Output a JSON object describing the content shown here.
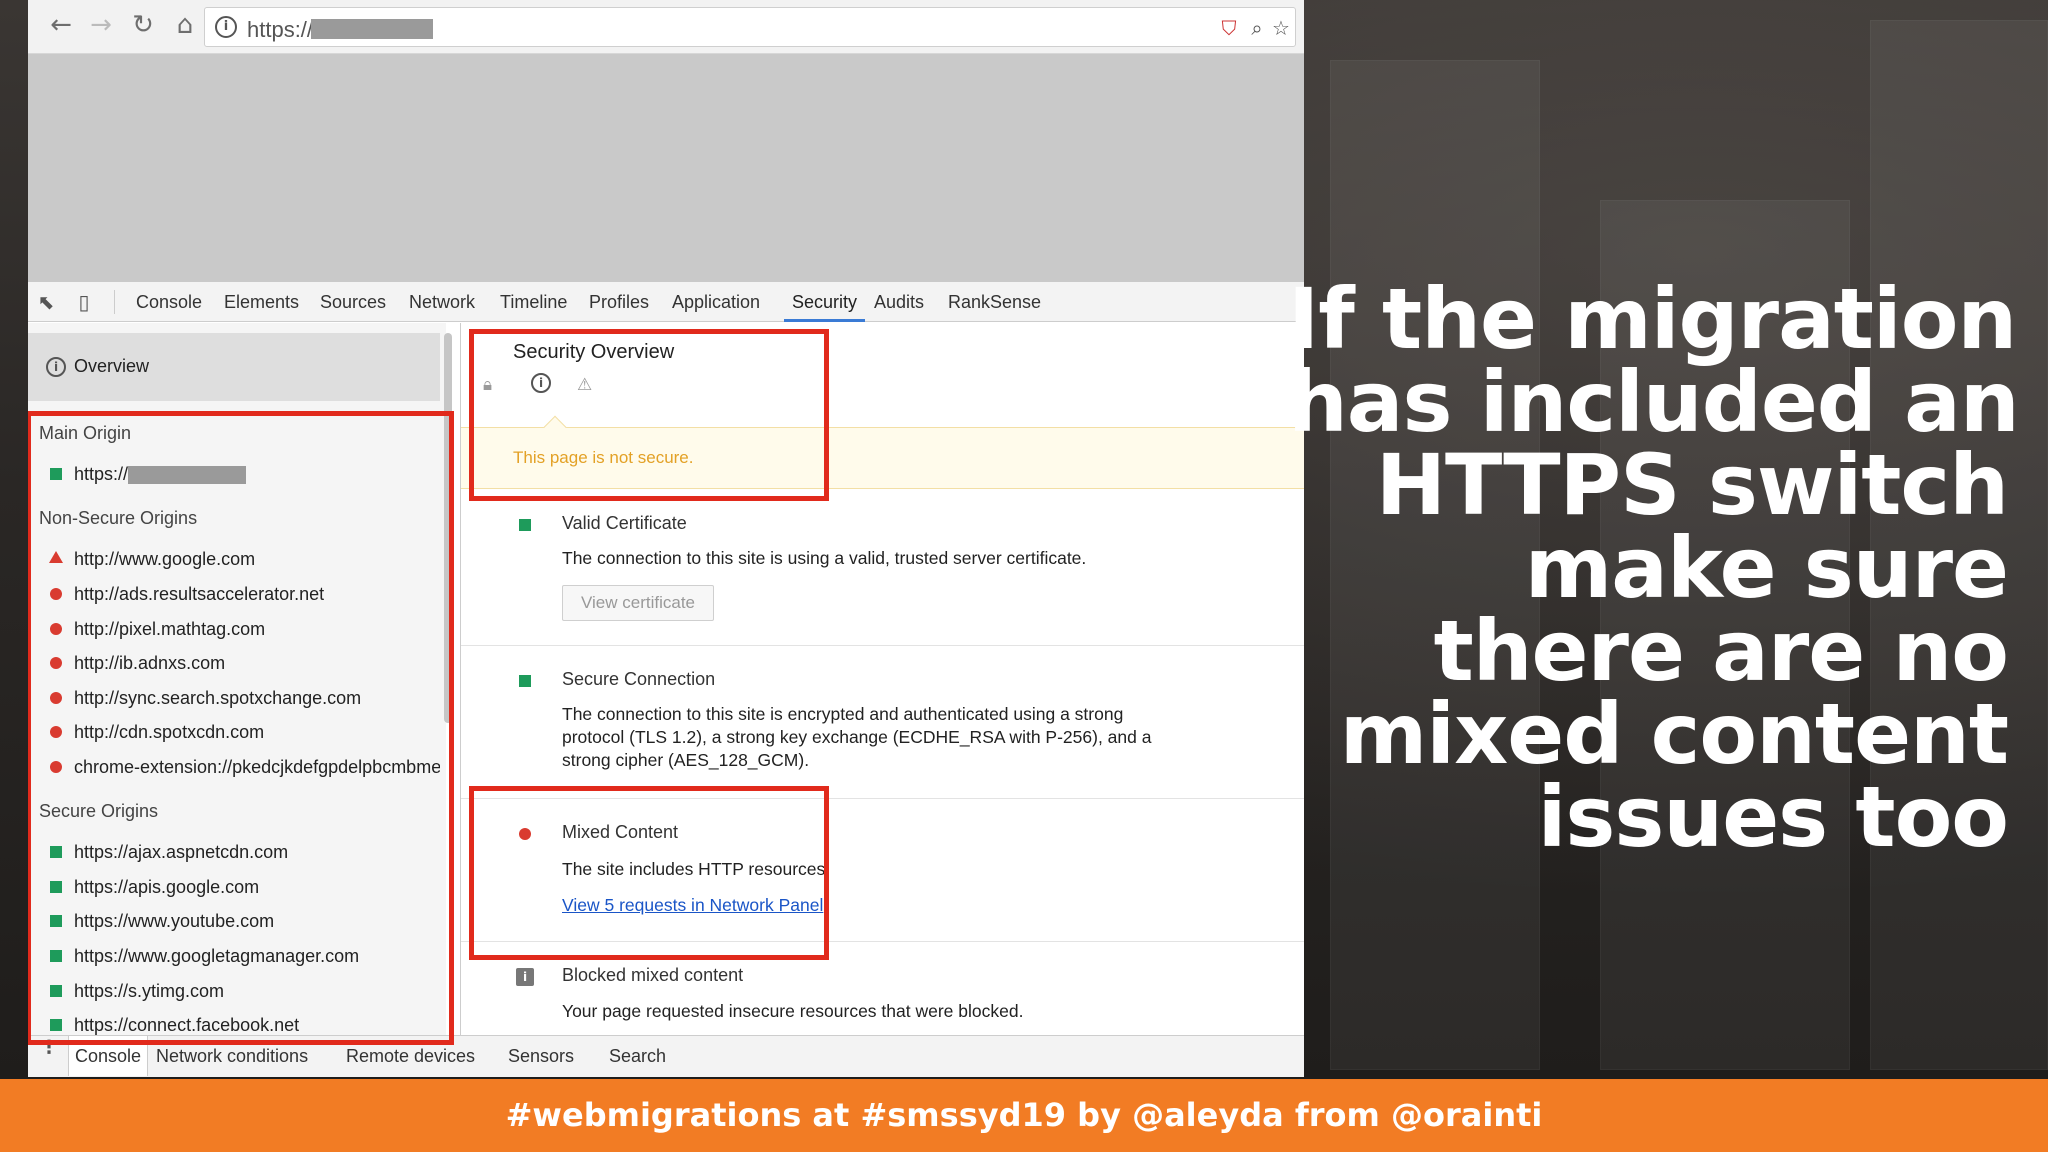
{
  "browser": {
    "url_prefix": "https://",
    "nav_icons": [
      "back-icon",
      "forward-icon",
      "reload-icon",
      "home-icon"
    ],
    "omnibar_icons": [
      "shield-icon",
      "zoom-icon",
      "star-icon"
    ]
  },
  "devtools": {
    "tabs": [
      "Console",
      "Elements",
      "Sources",
      "Network",
      "Timeline",
      "Profiles",
      "Application",
      "Security",
      "Audits",
      "RankSense"
    ],
    "active_tab": "Security",
    "sidebar": {
      "overview_label": "Overview",
      "main_origin_heading": "Main Origin",
      "main_origin_url": "https://",
      "non_secure_heading": "Non-Secure Origins",
      "non_secure_origins": [
        "http://www.google.com",
        "http://ads.resultsaccelerator.net",
        "http://pixel.mathtag.com",
        "http://ib.adnxs.com",
        "http://sync.search.spotxchange.com",
        "http://cdn.spotxcdn.com",
        "chrome-extension://pkedcjkdefgpdelpbcmbme"
      ],
      "secure_heading": "Secure Origins",
      "secure_origins": [
        "https://ajax.aspnetcdn.com",
        "https://apis.google.com",
        "https://www.youtube.com",
        "https://www.googletagmanager.com",
        "https://s.ytimg.com",
        "https://connect.facebook.net"
      ]
    },
    "main": {
      "title": "Security Overview",
      "warning": "This page is not secure.",
      "valid_cert": {
        "title": "Valid Certificate",
        "description": "The connection to this site is using a valid, trusted server certificate.",
        "button": "View certificate"
      },
      "secure_conn": {
        "title": "Secure Connection",
        "description": "The connection to this site is encrypted and authenticated using a strong protocol (TLS 1.2), a strong key exchange (ECDHE_RSA with P-256), and a strong cipher (AES_128_GCM)."
      },
      "mixed": {
        "title": "Mixed Content",
        "description": "The site includes HTTP resources.",
        "link": "View 5 requests in Network Panel"
      },
      "blocked": {
        "title": "Blocked mixed content",
        "description": "Your page requested insecure resources that were blocked."
      }
    },
    "drawer_tabs": [
      "Console",
      "Network conditions",
      "Remote devices",
      "Sensors",
      "Search"
    ],
    "drawer_active": "Console"
  },
  "headline": [
    "If the migration",
    "has included an",
    "HTTPS switch",
    "make sure",
    "there are no",
    "mixed content",
    "issues too"
  ],
  "footer": "#webmigrations at #smssyd19 by @aleyda from @orainti",
  "colors": {
    "footer_bg": "#f27c24",
    "highlight_red": "#e12a1c",
    "secure_green": "#1e9b5b",
    "insecure_red": "#d93b30",
    "link_blue": "#1a55c7"
  }
}
